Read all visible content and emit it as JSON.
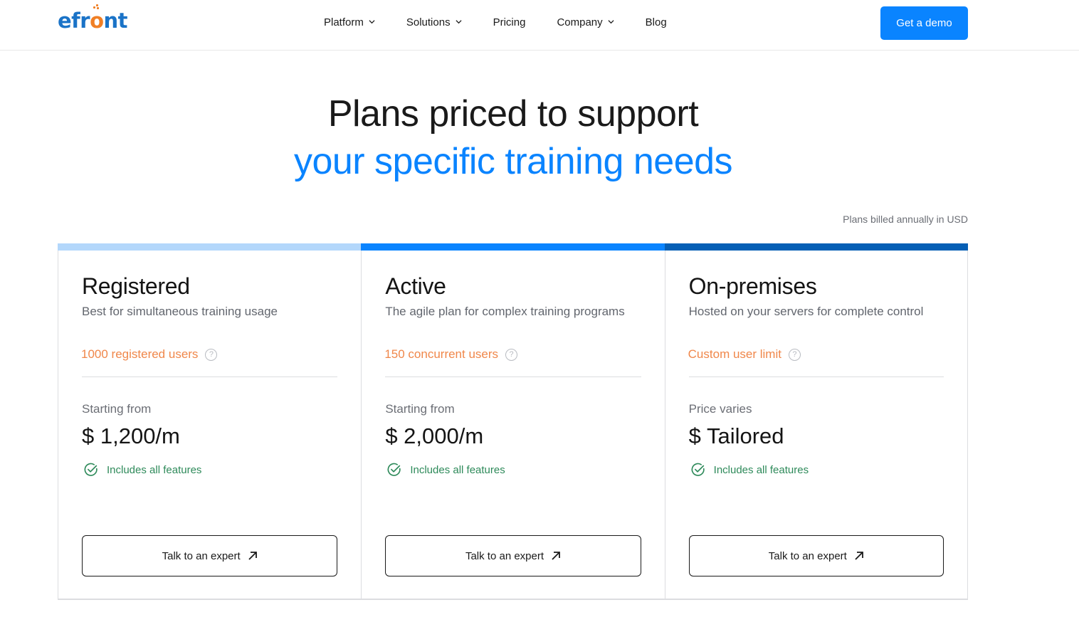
{
  "header": {
    "logo": {
      "prefix": "efr",
      "accent": "o",
      "suffix": "nt"
    },
    "nav": [
      {
        "label": "Platform",
        "has_dropdown": true
      },
      {
        "label": "Solutions",
        "has_dropdown": true
      },
      {
        "label": "Pricing",
        "has_dropdown": false
      },
      {
        "label": "Company",
        "has_dropdown": true
      },
      {
        "label": "Blog",
        "has_dropdown": false
      }
    ],
    "cta_label": "Get a demo"
  },
  "hero": {
    "line1": "Plans priced to support",
    "line2": "your specific training needs"
  },
  "billing_note": "Plans billed annually in USD",
  "colors": {
    "brand_blue": "#0a84ff",
    "logo_blue": "#1a73c7",
    "accent_orange": "#f0874a",
    "success_green": "#2e8a5a",
    "bar_registered": "#b3d7fb",
    "bar_active": "#0a84ff",
    "bar_onprem": "#055fb5"
  },
  "plans": [
    {
      "title": "Registered",
      "subtitle": "Best for simultaneous training usage",
      "users": "1000 registered users",
      "price_label": "Starting from",
      "price": "$ 1,200/m",
      "feature": "Includes all features",
      "cta": "Talk to an expert"
    },
    {
      "title": "Active",
      "subtitle": "The agile plan for complex training programs",
      "users": "150 concurrent users",
      "price_label": "Starting from",
      "price": "$ 2,000/m",
      "feature": "Includes all features",
      "cta": "Talk to an expert"
    },
    {
      "title": "On-premises",
      "subtitle": "Hosted on your servers for complete control",
      "users": "Custom user limit",
      "price_label": "Price varies",
      "price": "$ Tailored",
      "feature": "Includes all features",
      "cta": "Talk to an expert"
    }
  ]
}
